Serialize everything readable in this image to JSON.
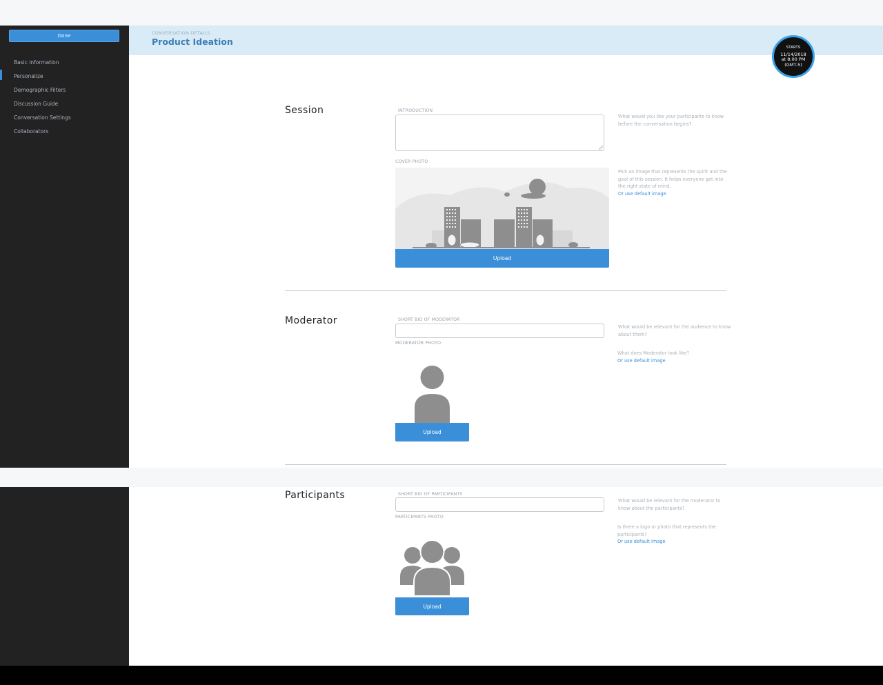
{
  "sidebar": {
    "done_label": "Done",
    "items": [
      {
        "label": "Basic information"
      },
      {
        "label": "Personalize"
      },
      {
        "label": "Demographic Filters"
      },
      {
        "label": "Discussion Guide"
      },
      {
        "label": "Conversation Settings"
      },
      {
        "label": "Collaborators"
      }
    ],
    "active_index": 1
  },
  "header": {
    "eyebrow": "CONVERSATION DETAILS",
    "title": "Product Ideation",
    "starts_label": "STARTS",
    "starts_date": "11/14/2018",
    "starts_time": "at 8:00 PM",
    "starts_tz": "(GMT-5)"
  },
  "session": {
    "title": "Session",
    "intro_label": "INTRODUCTION",
    "intro_value": "",
    "intro_help": "What would you like your participants to know before the conversation begins?",
    "cover_label": "COVER PHOTO",
    "cover_help": "Pick an image that represents the spirit and the goal of this session. It helps everyone get into the right state of mind.",
    "cover_link": "Or use default image",
    "upload_label": "Upload"
  },
  "moderator": {
    "title": "Moderator",
    "bio_label": "SHORT BIO OF MODERATOR",
    "bio_value": "",
    "bio_help": "What would be relevant for the audience to know about them?",
    "photo_label": "MODERATOR PHOTO",
    "photo_help": "What does Moderator look like?",
    "photo_link": "Or use default image",
    "upload_label": "Upload"
  },
  "participants": {
    "title": "Participants",
    "bio_label": "SHORT BIO OF PARTICIPANTS",
    "bio_value": "",
    "bio_help": "What would be relevant for the moderator to know about the participants?",
    "photo_label": "PARTICIPANTS PHOTO",
    "photo_help": "Is there a logo or photo that represents the participants?",
    "photo_link": "Or use default image",
    "upload_label": "Upload"
  },
  "colors": {
    "accent": "#3b8fd9",
    "sidebar_bg": "#222222",
    "header_bg": "#d9ebf7",
    "title_blue": "#3b7fb4",
    "placeholder_gray": "#8e8e8e"
  }
}
